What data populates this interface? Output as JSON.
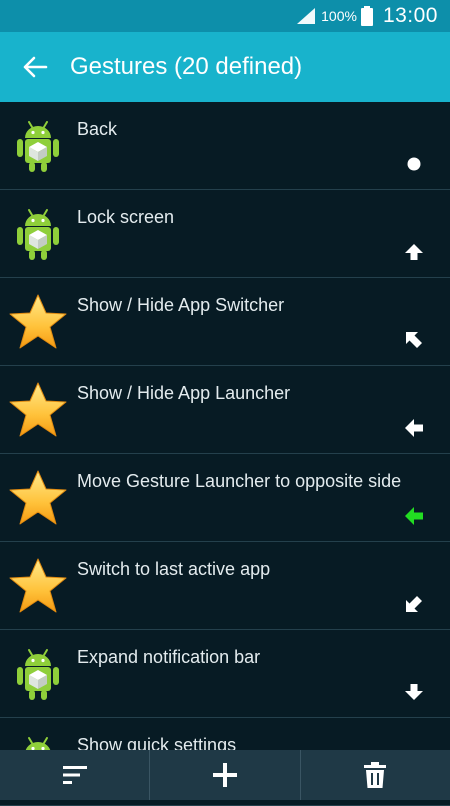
{
  "status_bar": {
    "battery_percent": "100%",
    "time": "13:00"
  },
  "header": {
    "title": "Gestures (20 defined)"
  },
  "gestures": [
    {
      "label": "Back",
      "icon": "android-icon",
      "gesture": "dot"
    },
    {
      "label": "Lock screen",
      "icon": "android-icon",
      "gesture": "arrow-up"
    },
    {
      "label": "Show / Hide App Switcher",
      "icon": "star-icon",
      "gesture": "arrow-up-left"
    },
    {
      "label": "Show / Hide App Launcher",
      "icon": "star-icon",
      "gesture": "arrow-left"
    },
    {
      "label": "Move Gesture Launcher to opposite side",
      "icon": "star-icon",
      "gesture": "arrow-left-green"
    },
    {
      "label": "Switch to last active app",
      "icon": "star-icon",
      "gesture": "arrow-down-left"
    },
    {
      "label": "Expand notification bar",
      "icon": "android-icon",
      "gesture": "arrow-down"
    },
    {
      "label": "Show quick settings",
      "icon": "android-icon",
      "gesture": "none"
    }
  ],
  "colors": {
    "status_bar": "#0d8faa",
    "app_bar": "#18b3cc",
    "background": "#071b24",
    "toolbar": "#1f3946",
    "gesture_highlight": "#22dd22"
  },
  "toolbar": {
    "sort_icon": "sort-icon",
    "add_icon": "plus-icon",
    "delete_icon": "trash-icon"
  }
}
